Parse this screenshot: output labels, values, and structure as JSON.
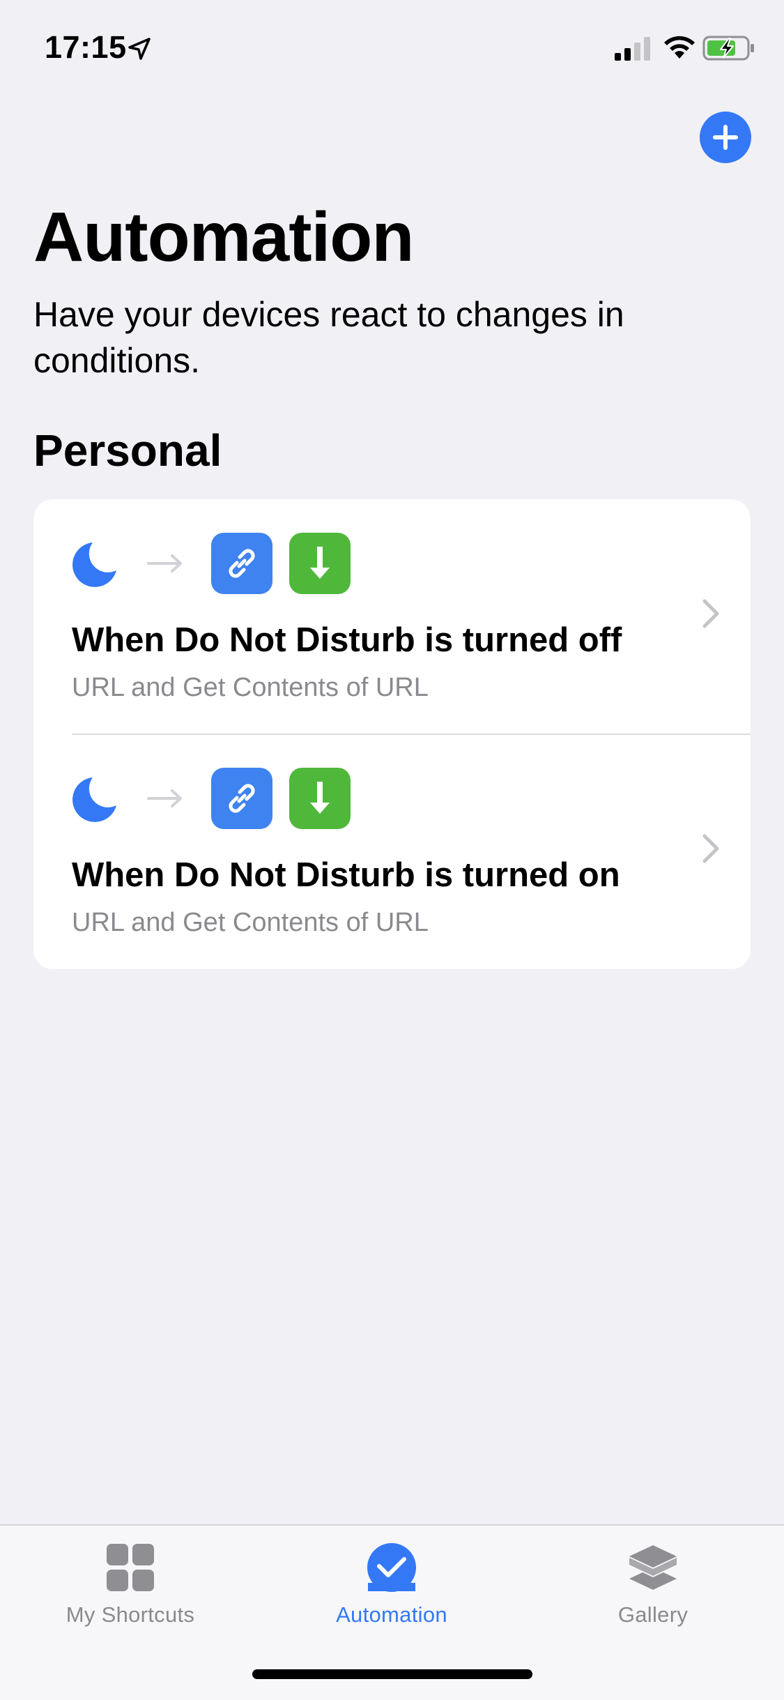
{
  "status_bar": {
    "time": "17:15",
    "location_icon": "location-arrow-icon",
    "signal_icon": "cellular-signal-icon",
    "wifi_icon": "wifi-icon",
    "battery_icon": "battery-charging-icon"
  },
  "header": {
    "add_icon": "plus-icon",
    "title": "Automation",
    "subtitle": "Have your devices react to changes in conditions."
  },
  "section": {
    "title": "Personal"
  },
  "automations": [
    {
      "title": "When Do Not Disturb is turned off",
      "subtitle": "URL and Get Contents of URL",
      "icons": [
        "moon-icon",
        "arrow-right-icon",
        "link-icon",
        "download-arrow-icon"
      ]
    },
    {
      "title": "When Do Not Disturb is turned on",
      "subtitle": "URL and Get Contents of URL",
      "icons": [
        "moon-icon",
        "arrow-right-icon",
        "link-icon",
        "download-arrow-icon"
      ]
    }
  ],
  "tab_bar": {
    "tabs": [
      {
        "label": "My Shortcuts",
        "icon": "grid-icon",
        "active": false
      },
      {
        "label": "Automation",
        "icon": "checkmark-circle-icon",
        "active": true
      },
      {
        "label": "Gallery",
        "icon": "layers-icon",
        "active": false
      }
    ]
  },
  "colors": {
    "accent": "#3478f6",
    "link_icon_bg": "#3f83f0",
    "download_icon_bg": "#4fb83a",
    "background": "#f0f0f5",
    "secondary_text": "#8a8a8e"
  }
}
